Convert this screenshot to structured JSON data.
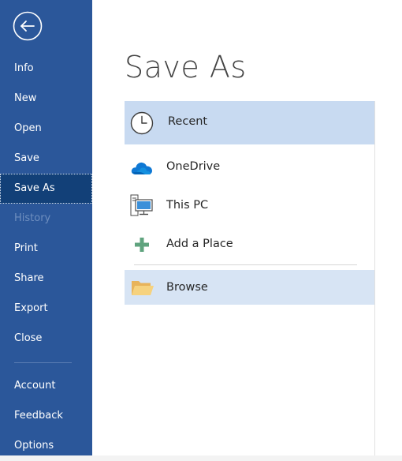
{
  "sidebar": {
    "items": [
      {
        "label": "Info"
      },
      {
        "label": "New"
      },
      {
        "label": "Open"
      },
      {
        "label": "Save"
      },
      {
        "label": "Save As"
      },
      {
        "label": "History"
      },
      {
        "label": "Print"
      },
      {
        "label": "Share"
      },
      {
        "label": "Export"
      },
      {
        "label": "Close"
      },
      {
        "label": "Account"
      },
      {
        "label": "Feedback"
      },
      {
        "label": "Options"
      }
    ],
    "active_item": "Save As",
    "disabled_items": [
      "History"
    ],
    "back_icon": "back-arrow-icon"
  },
  "main": {
    "title": "Save As",
    "locations": [
      {
        "label": "Recent",
        "icon": "clock-icon"
      },
      {
        "label": "OneDrive",
        "icon": "cloud-icon"
      },
      {
        "label": "This PC",
        "icon": "computer-icon"
      },
      {
        "label": "Add a Place",
        "icon": "plus-icon"
      },
      {
        "label": "Browse",
        "icon": "folder-icon"
      }
    ],
    "selected_location": "Recent"
  },
  "colors": {
    "sidebar_bg": "#2b579a",
    "sidebar_active_bg": "#124078",
    "selected_row_bg": "#c8daf1",
    "browse_row_bg": "#d7e4f4",
    "onedrive_blue": "#0364b8",
    "plus_green": "#5fa37e",
    "folder_yellow": "#f2c46f"
  }
}
